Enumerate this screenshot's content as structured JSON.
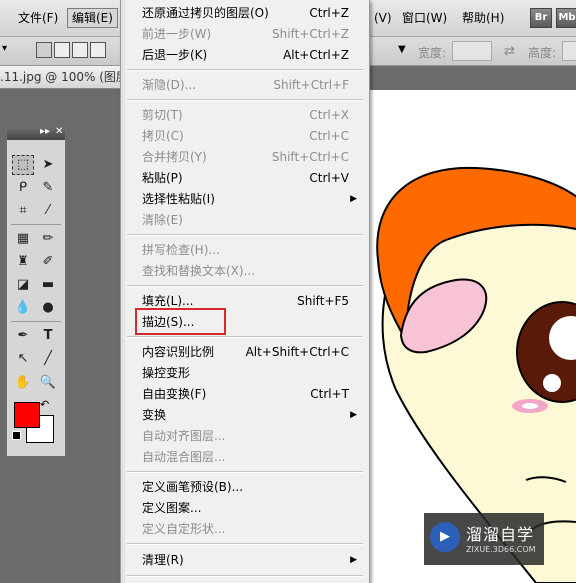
{
  "menubar": {
    "items": [
      {
        "label": "文件(F)"
      },
      {
        "label": "编辑(E)"
      },
      {
        "label": "(V)"
      },
      {
        "label": "窗口(W)"
      },
      {
        "label": "帮助(H)"
      }
    ],
    "br_label": "Br",
    "mb_label": "Mb"
  },
  "optbar": {
    "width_label": "宽度:",
    "height_label": "高度:"
  },
  "doctab": {
    "title": ".11.jpg @ 100% (图层 1"
  },
  "edit_menu": {
    "items": [
      {
        "label": "还原通过拷贝的图层(O)",
        "shortcut": "Ctrl+Z",
        "enabled": true
      },
      {
        "label": "前进一步(W)",
        "shortcut": "Shift+Ctrl+Z",
        "enabled": false
      },
      {
        "label": "后退一步(K)",
        "shortcut": "Alt+Ctrl+Z",
        "enabled": true
      },
      {
        "label": "渐隐(D)...",
        "shortcut": "Shift+Ctrl+F",
        "enabled": false
      },
      {
        "label": "剪切(T)",
        "shortcut": "Ctrl+X",
        "enabled": false
      },
      {
        "label": "拷贝(C)",
        "shortcut": "Ctrl+C",
        "enabled": false
      },
      {
        "label": "合并拷贝(Y)",
        "shortcut": "Shift+Ctrl+C",
        "enabled": false
      },
      {
        "label": "粘贴(P)",
        "shortcut": "Ctrl+V",
        "enabled": true
      },
      {
        "label": "选择性粘贴(I)",
        "shortcut": "",
        "enabled": true,
        "submenu": true
      },
      {
        "label": "清除(E)",
        "shortcut": "",
        "enabled": false
      },
      {
        "label": "拼写检查(H)...",
        "shortcut": "",
        "enabled": false
      },
      {
        "label": "查找和替换文本(X)...",
        "shortcut": "",
        "enabled": false
      },
      {
        "label": "填充(L)...",
        "shortcut": "Shift+F5",
        "enabled": true
      },
      {
        "label": "描边(S)...",
        "shortcut": "",
        "enabled": true,
        "highlighted": true
      },
      {
        "label": "内容识别比例",
        "shortcut": "Alt+Shift+Ctrl+C",
        "enabled": true
      },
      {
        "label": "操控变形",
        "shortcut": "",
        "enabled": true
      },
      {
        "label": "自由变换(F)",
        "shortcut": "Ctrl+T",
        "enabled": true
      },
      {
        "label": "变换",
        "shortcut": "",
        "enabled": true,
        "submenu": true
      },
      {
        "label": "自动对齐图层...",
        "shortcut": "",
        "enabled": false
      },
      {
        "label": "自动混合图层...",
        "shortcut": "",
        "enabled": false
      },
      {
        "label": "定义画笔预设(B)...",
        "shortcut": "",
        "enabled": true
      },
      {
        "label": "定义图案...",
        "shortcut": "",
        "enabled": true
      },
      {
        "label": "定义自定形状...",
        "shortcut": "",
        "enabled": false
      },
      {
        "label": "清理(R)",
        "shortcut": "",
        "enabled": true,
        "submenu": true
      }
    ],
    "arrow_glyph": "▶"
  },
  "toolbox": {
    "header_glyphs": "▸▸ ×",
    "foreground_color": "#ff0000",
    "background_color": "#ffffff",
    "tools": [
      "marquee-tool",
      "move-tool",
      "lasso-tool",
      "quick-select-tool",
      "crop-tool",
      "eyedropper-tool",
      "healing-tool",
      "brush-tool",
      "stamp-tool",
      "history-brush-tool",
      "eraser-tool",
      "gradient-tool",
      "blur-tool",
      "dodge-tool",
      "pen-tool",
      "type-tool",
      "path-select-tool",
      "line-tool",
      "hand-tool",
      "zoom-tool"
    ]
  },
  "watermark": {
    "title": "溜溜自学",
    "url": "ZIXUE.3D66.COM"
  }
}
